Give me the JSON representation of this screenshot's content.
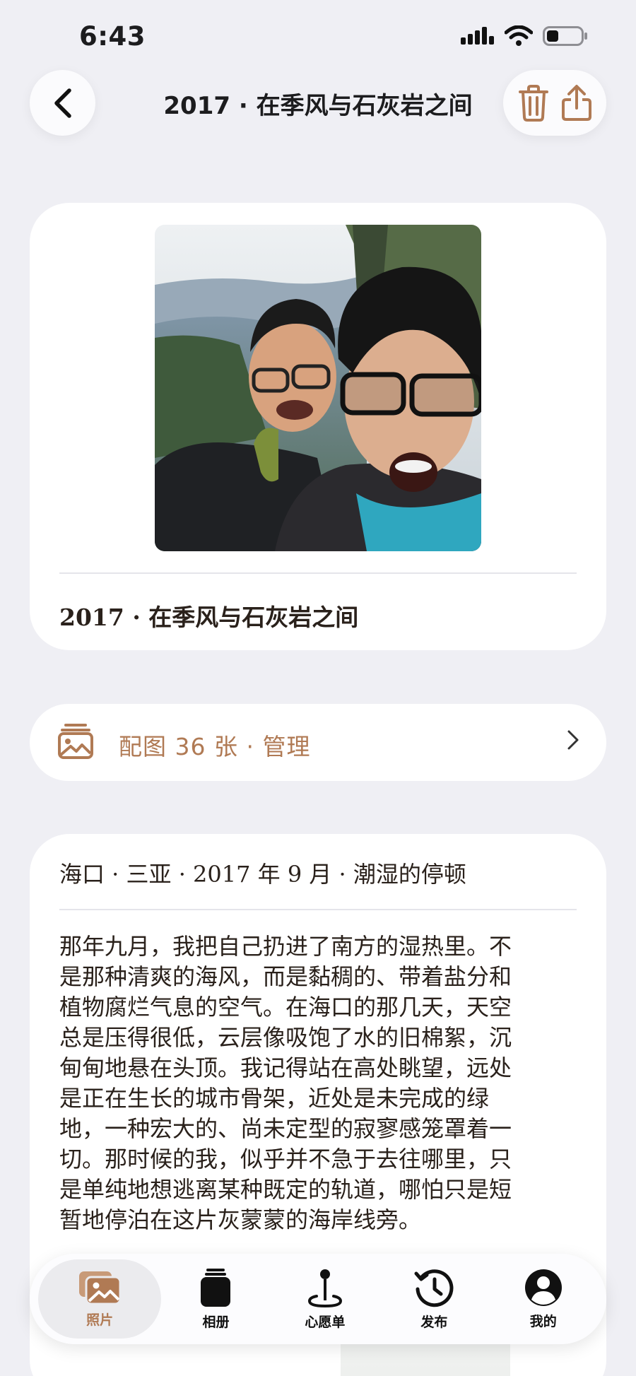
{
  "status_bar": {
    "time": "6:43",
    "icons": [
      "cellular-signal-icon",
      "wifi-icon",
      "battery-icon"
    ]
  },
  "nav": {
    "title": "2017 · 在季风与石灰岩之间",
    "back_icon": "chevron-left-icon",
    "actions": [
      "trash-icon",
      "share-icon"
    ]
  },
  "cover_card": {
    "caption": "2017 · 在季风与石灰岩之间"
  },
  "manage_row": {
    "label": "配图 36 张 · 管理",
    "icon": "photo-stack-icon"
  },
  "story": {
    "meta": "海口 · 三亚 · 2017 年 9 月 · 潮湿的停顿",
    "lines": [
      "那年九月，我把自己扔进了南方的湿热里。不",
      "是那种清爽的海风，而是黏稠的、带着盐分和",
      "植物腐烂气息的空气。在海口的那几天，天空",
      "总是压得很低，云层像吸饱了水的旧棉絮，沉",
      "甸甸地悬在头顶。我记得站在高处眺望，远处",
      "是正在生长的城市骨架，近处是未完成的绿",
      "地，一种宏大的、尚未定型的寂寥感笼罩着一",
      "切。那时候的我，似乎并不急于去往哪里，只",
      "是单纯地想逃离某种既定的轨道，哪怕只是短",
      "暂地停泊在这片灰蒙蒙的海岸线旁。"
    ]
  },
  "tab_bar": {
    "tabs": [
      {
        "label": "照片",
        "icon": "photos-icon",
        "active": true
      },
      {
        "label": "相册",
        "icon": "album-jar-icon",
        "active": false
      },
      {
        "label": "心愿单",
        "icon": "map-pin-icon",
        "active": false
      },
      {
        "label": "发布",
        "icon": "history-clock-icon",
        "active": false
      },
      {
        "label": "我的",
        "icon": "profile-icon",
        "active": false
      }
    ]
  },
  "colors": {
    "accent": "#b07a54",
    "background": "#efeff4",
    "card": "#ffffff",
    "text": "#2a211b"
  }
}
